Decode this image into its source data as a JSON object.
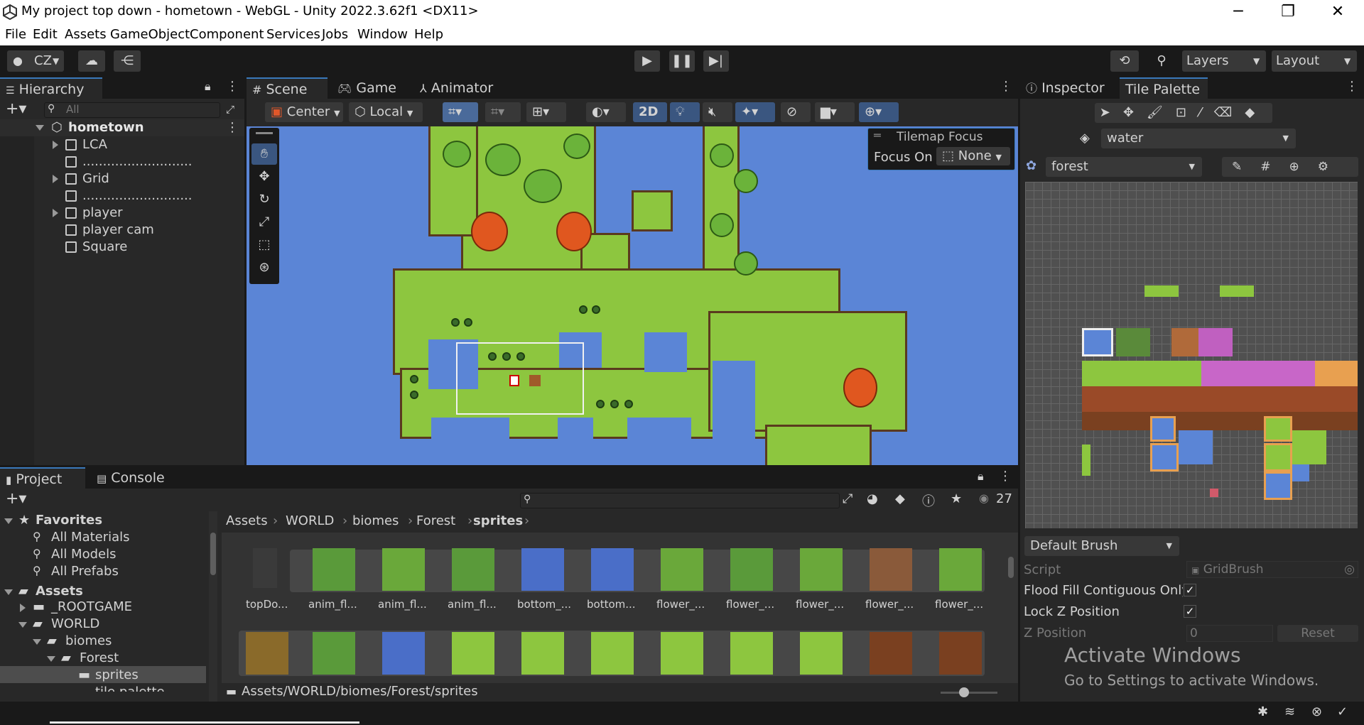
{
  "window": {
    "title": "My project top down - hometown - WebGL - Unity 2022.3.62f1 <DX11>",
    "min": "─",
    "max": "❐",
    "close": "✕"
  },
  "menu": [
    "File",
    "Edit",
    "Assets",
    "GameObject",
    "Component",
    "Services",
    "Jobs",
    "Window",
    "Help"
  ],
  "toolbar": {
    "account": "CZ",
    "layers": "Layers",
    "layout": "Layout"
  },
  "hierarchy": {
    "tab": "Hierarchy",
    "search_placeholder": "All",
    "root": "hometown",
    "items": [
      "LCA",
      "...........................",
      "Grid",
      "...........................",
      "player",
      "player cam",
      "Square"
    ]
  },
  "scene_tabs": {
    "scene": "Scene",
    "game": "Game",
    "animator": "Animator"
  },
  "scene_toolbar": {
    "pivot": "Center",
    "space": "Local",
    "mode2d": "2D"
  },
  "tilemap_focus": {
    "title": "Tilemap Focus",
    "label": "Focus On",
    "value": "None"
  },
  "inspector": {
    "tab_inspector": "Inspector",
    "tab_palette": "Tile Palette",
    "layer": "water",
    "palette": "forest",
    "brush": "Default Brush",
    "script_label": "Script",
    "script_value": "GridBrush",
    "flood_label": "Flood Fill Contiguous Only",
    "lockz_label": "Lock Z Position",
    "zpos_label": "Z Position",
    "zpos_value": "0",
    "reset": "Reset"
  },
  "project": {
    "tab_project": "Project",
    "tab_console": "Console",
    "count": "27",
    "favorites": "Favorites",
    "fav_items": [
      "All Materials",
      "All Models",
      "All Prefabs"
    ],
    "assets": "Assets",
    "tree": [
      "_ROOTGAME",
      "WORLD",
      "biomes",
      "Forest",
      "sprites",
      "tile palette"
    ],
    "breadcrumb": [
      "Assets",
      "WORLD",
      "biomes",
      "Forest",
      "sprites"
    ],
    "assets_row1": [
      "topDo...",
      "anim_fl...",
      "anim_fl...",
      "anim_fl...",
      "bottom_...",
      "bottom...",
      "flower_...",
      "flower_...",
      "flower_...",
      "flower_...",
      "flower_..."
    ],
    "path": "Assets/WORLD/biomes/Forest/sprites"
  },
  "watermark": {
    "line1": "Activate Windows",
    "line2": "Go to Settings to activate Windows."
  }
}
